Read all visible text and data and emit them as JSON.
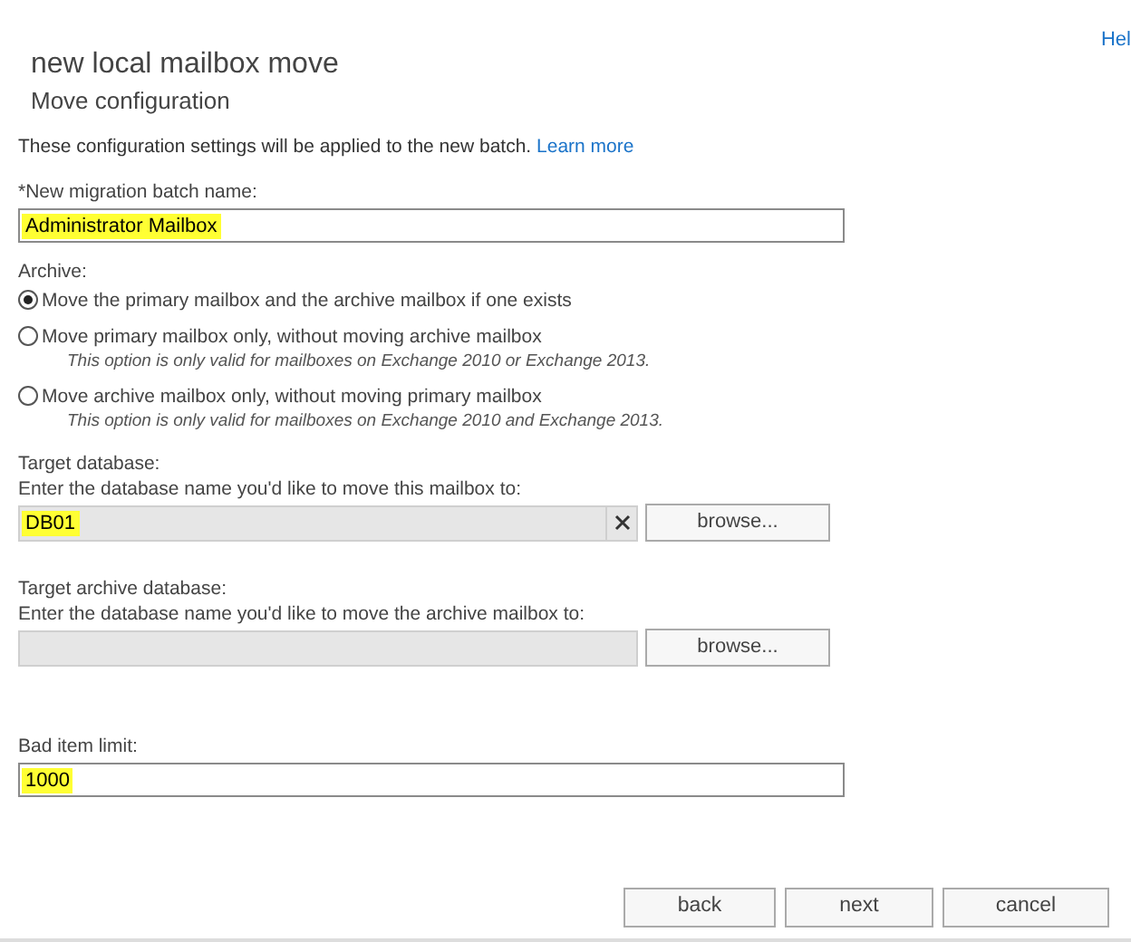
{
  "help_link": "Hel",
  "title": "new local mailbox move",
  "subtitle": "Move configuration",
  "description": {
    "text": "These configuration settings will be applied to the new batch.",
    "link": "Learn more"
  },
  "batch_name": {
    "label": "*New migration batch name:",
    "value": "Administrator Mailbox",
    "highlighted": true
  },
  "archive": {
    "label": "Archive:",
    "options": [
      {
        "label": "Move the primary mailbox and the archive mailbox if one exists",
        "selected": true
      },
      {
        "label": "Move primary mailbox only, without moving archive mailbox",
        "note": "This option is only valid for mailboxes on Exchange 2010 or Exchange 2013.",
        "selected": false
      },
      {
        "label": "Move archive mailbox only, without moving primary mailbox",
        "note": "This option is only valid for mailboxes on Exchange 2010 and Exchange 2013.",
        "selected": false
      }
    ]
  },
  "target_database": {
    "label": "Target database:",
    "hint": "Enter the database name you'd like to move this mailbox to:",
    "value": "DB01",
    "highlighted": true,
    "clear_button": true,
    "browse": "browse..."
  },
  "target_archive_database": {
    "label": "Target archive database:",
    "hint": "Enter the database name you'd like to move the archive mailbox to:",
    "browse": "browse..."
  },
  "bad_item_limit": {
    "label": "Bad item limit:",
    "value": "1000",
    "highlighted": true
  },
  "buttons": [
    "back",
    "next",
    "cancel"
  ]
}
